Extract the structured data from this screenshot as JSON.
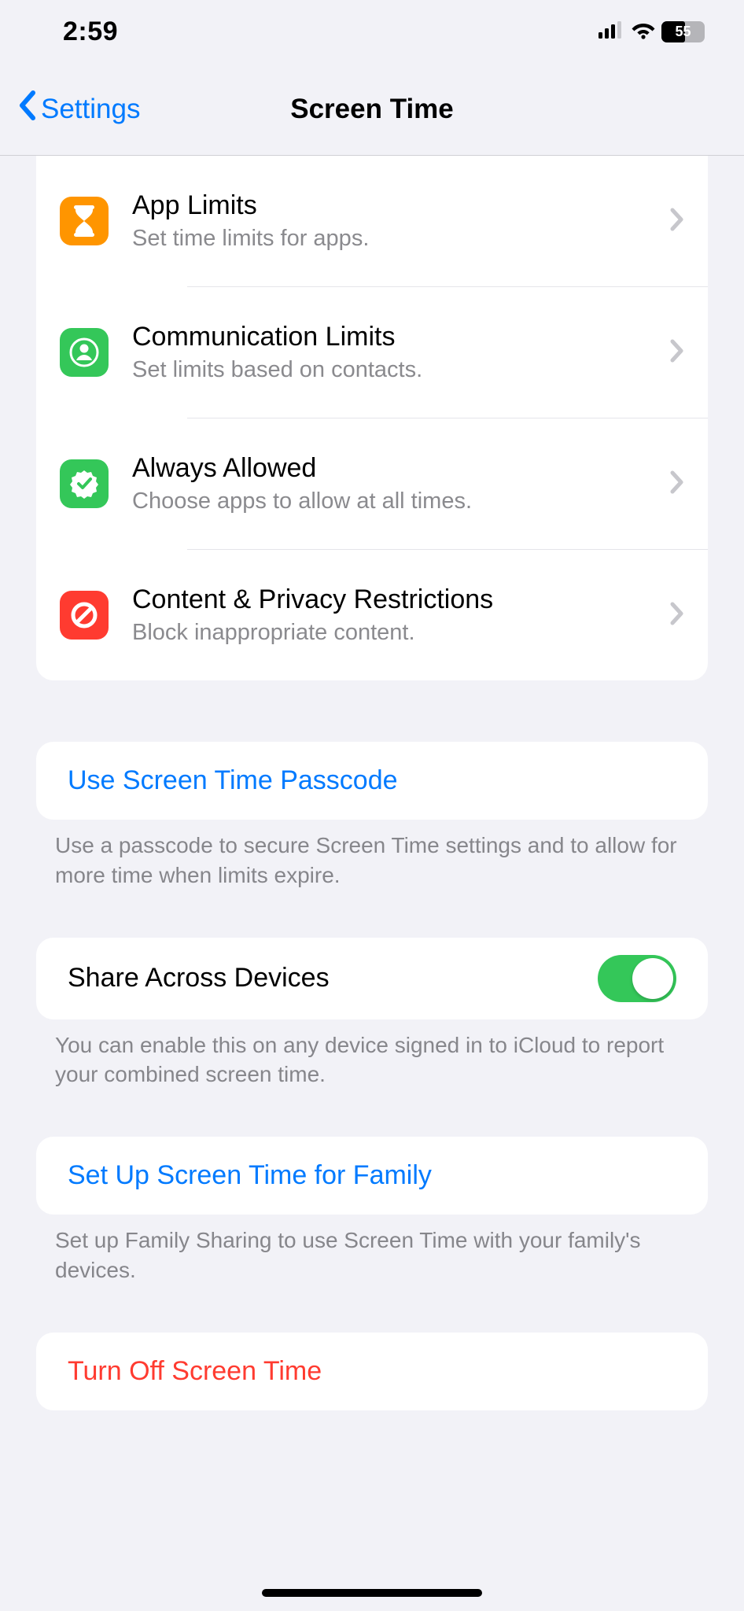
{
  "status": {
    "time": "2:59",
    "battery": "55"
  },
  "nav": {
    "back": "Settings",
    "title": "Screen Time"
  },
  "rows": {
    "appLimits": {
      "title": "App Limits",
      "subtitle": "Set time limits for apps."
    },
    "commLimits": {
      "title": "Communication Limits",
      "subtitle": "Set limits based on contacts."
    },
    "alwaysAllowed": {
      "title": "Always Allowed",
      "subtitle": "Choose apps to allow at all times."
    },
    "contentPrivacy": {
      "title": "Content & Privacy Restrictions",
      "subtitle": "Block inappropriate content."
    }
  },
  "passcode": {
    "label": "Use Screen Time Passcode",
    "footer": "Use a passcode to secure Screen Time settings and to allow for more time when limits expire."
  },
  "share": {
    "label": "Share Across Devices",
    "footer": "You can enable this on any device signed in to iCloud to report your combined screen time."
  },
  "family": {
    "label": "Set Up Screen Time for Family",
    "footer": "Set up Family Sharing to use Screen Time with your family's devices."
  },
  "turnOff": {
    "label": "Turn Off Screen Time"
  }
}
